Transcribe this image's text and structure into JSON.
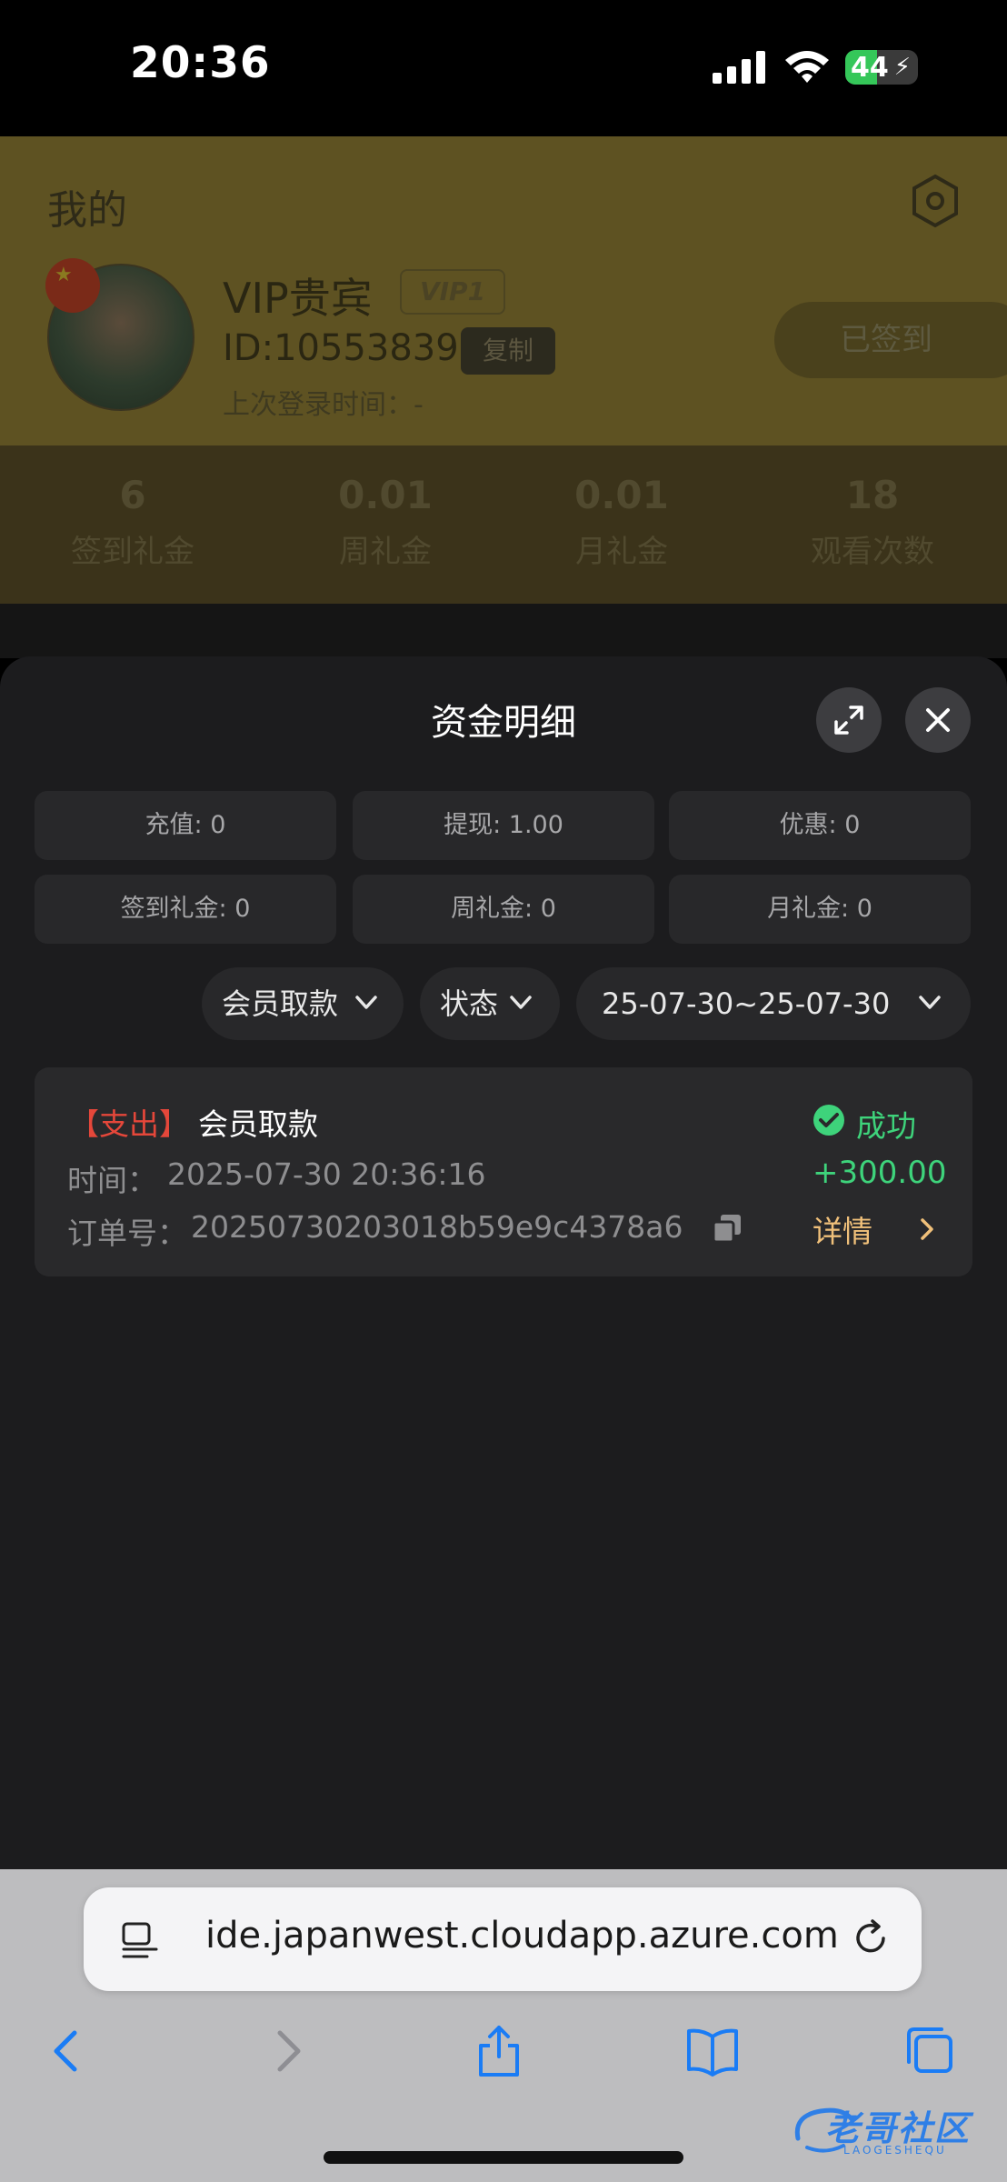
{
  "status_bar": {
    "time": "20:36",
    "battery": "44"
  },
  "background_page": {
    "title": "我的",
    "vip_name": "VIP贵宾",
    "vip_badge": "VIP1",
    "user_id": "ID:10553839",
    "copy_label": "复制",
    "last_login": "上次登录时间：-",
    "signed_button": "已签到",
    "stats": [
      {
        "value": "6",
        "label": "签到礼金"
      },
      {
        "value": "0.01",
        "label": "周礼金"
      },
      {
        "value": "0.01",
        "label": "月礼金"
      },
      {
        "value": "18",
        "label": "观看次数"
      }
    ]
  },
  "sheet": {
    "title": "资金明细",
    "summary": [
      "充值: 0",
      "提现: 1.00",
      "优惠: 0",
      "签到礼金: 0",
      "周礼金: 0",
      "月礼金: 0"
    ],
    "filters": {
      "type": "会员取款",
      "status": "状态",
      "date_range": "25-07-30~25-07-30"
    },
    "record": {
      "tag": "【支出】",
      "title": "会员取款",
      "time_label": "时间：",
      "time_value": "2025-07-30 20:36:16",
      "order_label": "订单号：",
      "order_value": "20250730203018b59e9c4378a6",
      "status": "成功",
      "amount": "+300.00",
      "detail_label": "详情"
    }
  },
  "browser": {
    "url": "ide.japanwest.cloudapp.azure.com"
  },
  "watermark": {
    "text": "老哥社区",
    "sub": "LAOGESHEQU"
  }
}
